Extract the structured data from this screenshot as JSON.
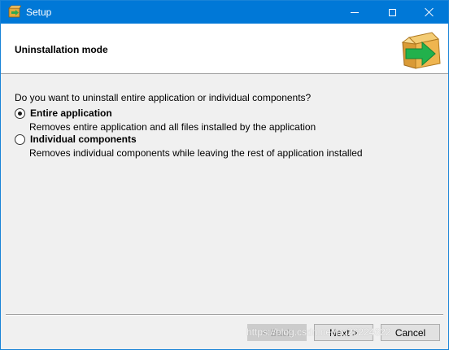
{
  "window": {
    "title": "Setup",
    "controls": {
      "minimize": "minimize",
      "maximize": "maximize",
      "close": "close"
    }
  },
  "header": {
    "title": "Uninstallation mode",
    "image": "open-box-arrow-icon"
  },
  "content": {
    "question": "Do you want to uninstall entire application or individual components?",
    "options": [
      {
        "label": "Entire application",
        "description": "Removes entire application and all files installed by the application",
        "selected": true
      },
      {
        "label": "Individual components",
        "description": "Removes individual components while leaving the rest of application installed",
        "selected": false
      }
    ]
  },
  "footer": {
    "back_label": "< Back",
    "next_label": "Next >",
    "cancel_label": "Cancel",
    "watermark": "https://blog.csdn.net/qq26224622"
  },
  "colors": {
    "titlebar": "#0078d7",
    "dialog_bg": "#f0f0f0",
    "header_bg": "#ffffff"
  }
}
